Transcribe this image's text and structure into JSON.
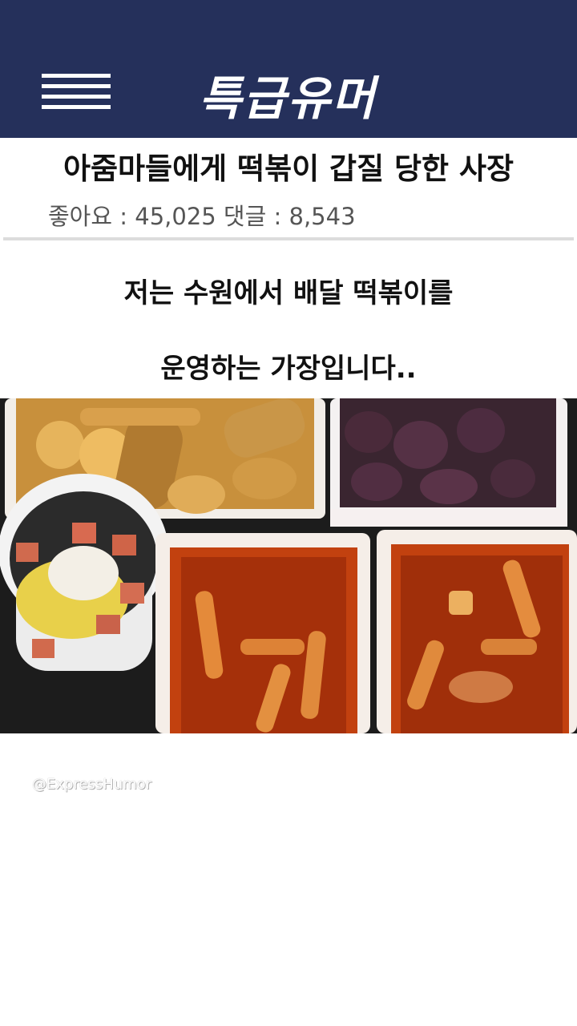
{
  "header": {
    "brand": "특급유머",
    "menu_icon": "hamburger-menu-icon"
  },
  "post": {
    "title": "아줌마들에게 떡볶이 갑질 당한 사장",
    "stats": "좋아요 : 45,025 댓글 : 8,543",
    "body_lines": [
      "저는 수원에서 배달 떡볶이를",
      "운영하는 가장입니다.."
    ]
  },
  "watermark": "@ExpressHumor",
  "colors": {
    "header_bg": "#25305b",
    "divider": "#dcdcdc"
  }
}
